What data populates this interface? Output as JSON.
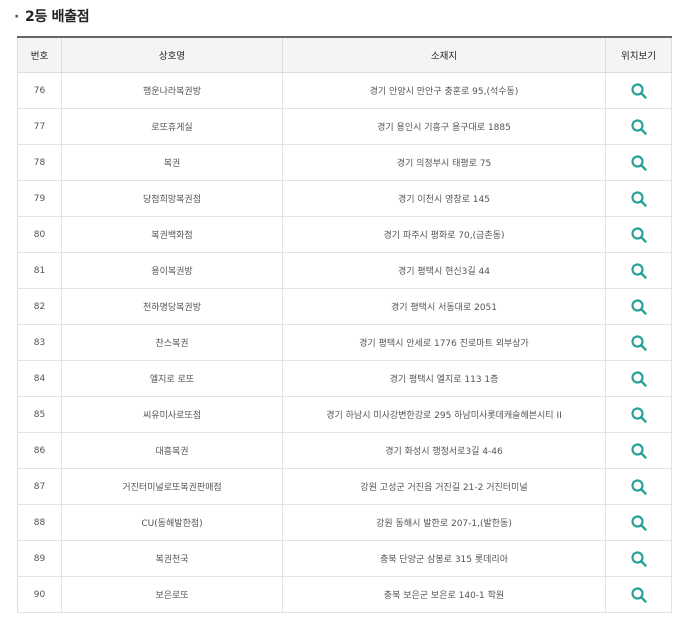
{
  "section": {
    "bullet": "·",
    "title": "2등 배출점"
  },
  "table": {
    "headers": {
      "no": "번호",
      "name": "상호명",
      "address": "소재지",
      "location": "위치보기"
    },
    "rows": [
      {
        "no": "76",
        "name": "행운나라복권방",
        "address": "경기 안양시 만안구 충훈로 95,(석수동)"
      },
      {
        "no": "77",
        "name": "로또휴게실",
        "address": "경기 용인시 기흥구 용구대로 1885"
      },
      {
        "no": "78",
        "name": "복권",
        "address": "경기 의정부시 태평로 75"
      },
      {
        "no": "79",
        "name": "당첨희망복권점",
        "address": "경기 이천시 영창로 145"
      },
      {
        "no": "80",
        "name": "복권백화점",
        "address": "경기 파주시 평화로 70,(금촌동)"
      },
      {
        "no": "81",
        "name": "용이복권방",
        "address": "경기 평택시 현신3길 44"
      },
      {
        "no": "82",
        "name": "천하명당복권방",
        "address": "경기 평택시 서동대로 2051"
      },
      {
        "no": "83",
        "name": "찬스복권",
        "address": "경기 평택시 안세로 1776 진로마트 외부상가"
      },
      {
        "no": "84",
        "name": "엘지로 로또",
        "address": "경기 평택시 엘지로 113 1층"
      },
      {
        "no": "85",
        "name": "씨유미사로또점",
        "address": "경기 하남시 미사강변한강로 295 하남미사롯데캐슬헤븐시티 II"
      },
      {
        "no": "86",
        "name": "대흥복권",
        "address": "경기 화성시 행정서로3길 4-46"
      },
      {
        "no": "87",
        "name": "거진터미널로또복권판매점",
        "address": "강원 고성군 거진읍 거진길 21-2 거진터미널"
      },
      {
        "no": "88",
        "name": "CU(동해발한점)",
        "address": "강원 동해시 발한로 207-1,(발한동)"
      },
      {
        "no": "89",
        "name": "복권천국",
        "address": "충북 단양군 삼봉로 315 롯데리아"
      },
      {
        "no": "90",
        "name": "보은로또",
        "address": "충북 보은군 보은로 140-1 학원"
      }
    ]
  },
  "colors": {
    "icon": "#2aa198",
    "header_bg": "#f4f4f4",
    "border": "#e3e3e3"
  },
  "icons": {
    "location": "search-icon"
  }
}
